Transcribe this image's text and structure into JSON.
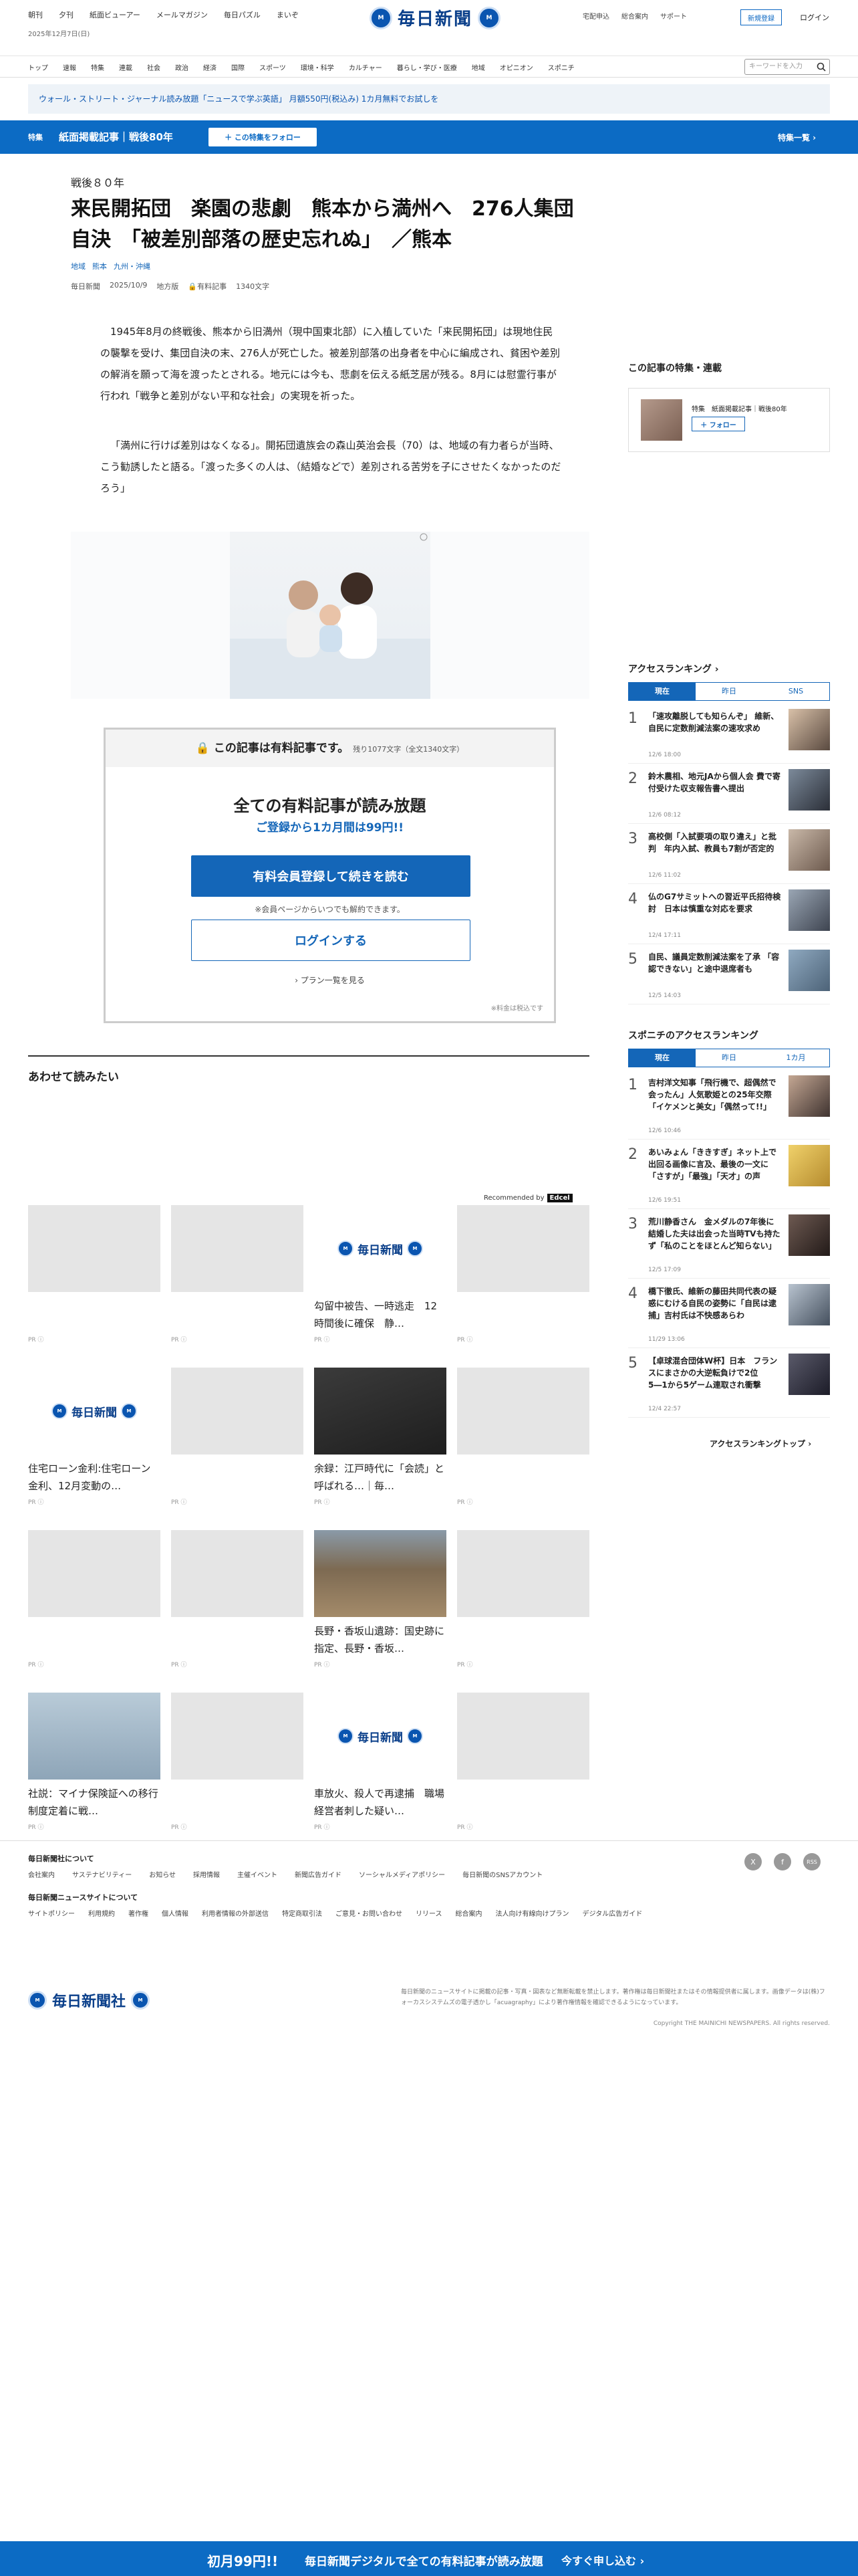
{
  "header": {
    "top_links": [
      "朝刊",
      "夕刊",
      "紙面ビューアー",
      "メールマガジン",
      "毎日パズル",
      "まいぞ"
    ],
    "date": "2025年12月7日(日)",
    "logo": "毎日新聞",
    "right_links": [
      "宅配申込",
      "総合案内",
      "サポート"
    ],
    "register": "新規登録",
    "login": "ログイン"
  },
  "nav": {
    "items": [
      "トップ",
      "速報",
      "特集",
      "連載",
      "社会",
      "政治",
      "経済",
      "国際",
      "スポーツ",
      "環境・科学",
      "カルチャー",
      "暮らし・学び・医療",
      "地域",
      "オピニオン",
      "スポニチ"
    ],
    "search_placeholder": "キーワードを入力"
  },
  "promo": "ウォール・ストリート・ジャーナル読み放題「ニュースで学ぶ英語」 月額550円(税込み) 1カ月無料でお試しを",
  "feature": {
    "tag": "特集",
    "title": "紙面掲載記事｜戦後80年",
    "follow": "＋ この特集をフォロー",
    "list": "特集一覧 ›"
  },
  "article": {
    "kicker": "戦後８０年",
    "headline": "来民開拓団　楽園の悲劇　熊本から満州へ　276人集団自決　「被差別部落の歴史忘れぬ」　／熊本",
    "tags": [
      "地域",
      "熊本",
      "九州・沖縄"
    ],
    "meta": [
      "毎日新聞",
      "2025/10/9",
      "地方版",
      "有料記事",
      "1340文字"
    ],
    "p1": "1945年8月の終戦後、熊本から旧満州（現中国東北部）に入植していた「来民開拓団」は現地住民の襲撃を受け、集団自決の末、276人が死亡した。被差別部落の出身者を中心に編成され、貧困や差別の解消を願って海を渡ったとされる。地元には今も、悲劇を伝える紙芝居が残る。8月には慰霊行事が行われ「戦争と差別がない平和な社会」の実現を祈った。",
    "p2": "「満州に行けば差別はなくなる」。開拓団遺族会の森山英治会長（70）は、地域の有力者らが当時、こう勧誘したと語る。「渡った多くの人は、（結婚などで）差別される苦労を子にさせたくなかったのだろう」"
  },
  "paywall": {
    "head": "この記事は有料記事です。",
    "remaining": "残り1077文字（全文1340文字）",
    "title": "全ての有料記事が読み放題",
    "subtitle": "ご登録から1カ月間は99円!!",
    "primary": "有料会員登録して続きを読む",
    "note": "※会員ページからいつでも解約できます。",
    "login": "ログインする",
    "plans": "› プラン一覧を見る",
    "tax": "※料金は税込です"
  },
  "related": {
    "title": "あわせて読みたい",
    "recommended": "Recommended by",
    "recommender": "Edcel",
    "pr": "PR ⓘ",
    "cards": [
      {
        "title": ""
      },
      {
        "title": ""
      },
      {
        "title": "勾留中被告、一時逃走　12時間後に確保　静…"
      },
      {
        "title": ""
      },
      {
        "title": "住宅ローン金利:住宅ローン金利、12月変動の…"
      },
      {
        "title": ""
      },
      {
        "title": "余録：江戸時代に「会読」と呼ばれる…｜毎…"
      },
      {
        "title": ""
      },
      {
        "title": ""
      },
      {
        "title": ""
      },
      {
        "title": "長野・香坂山遺跡：国史跡に指定、長野・香坂…"
      },
      {
        "title": ""
      },
      {
        "title": "社説：マイナ保険証への移行　制度定着に戦…"
      },
      {
        "title": ""
      },
      {
        "title": "車放火、殺人で再逮捕　職場経営者刺した疑い…"
      },
      {
        "title": ""
      }
    ]
  },
  "sidebar": {
    "series_title": "この記事の特集・連載",
    "series_label": "特集　紙面掲載記事｜戦後80年",
    "series_follow": "＋ フォロー",
    "ranking_title": "アクセスランキング ›",
    "ranking_tabs": [
      "現在",
      "昨日",
      "SNS"
    ],
    "ranking": [
      {
        "n": "1",
        "t": "「速攻離脱しても知らんぞ」 維新、自民に定数削減法案の速攻求め",
        "d": "12/6 18:00"
      },
      {
        "n": "2",
        "t": "鈴木農相、地元JAから個人会 費で寄付受けた収支報告書へ提出",
        "d": "12/6 08:12"
      },
      {
        "n": "3",
        "t": "高校側「入試要項の取り違え」と批判　年内入試、教員も7割が否定的",
        "d": "12/6 11:02"
      },
      {
        "n": "4",
        "t": "仏のG7サミットへの習近平氏招待検討　日本は慎重な対応を要求",
        "d": "12/4 17:11"
      },
      {
        "n": "5",
        "t": "自民、議員定数削減法案を了承 「容認できない」と途中退席者も",
        "d": "12/5 14:03"
      }
    ],
    "sponichi_title": "スポニチのアクセスランキング",
    "sponichi_tabs": [
      "現在",
      "昨日",
      "1カ月"
    ],
    "sponichi": [
      {
        "n": "1",
        "t": "吉村洋文知事「飛行機で、超偶然で会ったん」人気歌姫との25年交際「イケメンと美女」「偶然って!!」",
        "d": "12/6 10:46"
      },
      {
        "n": "2",
        "t": "あいみょん「ききすぎ」ネット上で出回る画像に言及、最後の一文に「さすが」「最強」「天才」の声",
        "d": "12/6 19:51"
      },
      {
        "n": "3",
        "t": "荒川静香さん　金メダルの7年後に結婚した夫は出会った当時TVも持たず「私のことをほとんど知らない」",
        "d": "12/5 17:09"
      },
      {
        "n": "4",
        "t": "橋下徹氏、維新の藤田共同代表の疑惑にむける自民の姿勢に「自民は逮捕」吉村氏は不快感あらわ",
        "d": "11/29 13:06"
      },
      {
        "n": "5",
        "t": "【卓球混合団体W杯】日本　フランスにまさかの大逆転負けで2位　5―1から5ゲーム連取され衝撃",
        "d": "12/4 22:57"
      }
    ],
    "ranking_top": "アクセスランキングトップ ›"
  },
  "footer": {
    "about": "毎日新聞社について",
    "links1": [
      "会社案内",
      "サステナビリティー",
      "お知らせ",
      "採用情報",
      "主催イベント",
      "新聞広告ガイド",
      "ソーシャルメディアポリシー",
      "毎日新聞のSNSアカウント"
    ],
    "site": "毎日新聞ニュースサイトについて",
    "links2": [
      "サイトポリシー",
      "利用規約",
      "著作権",
      "個人情報",
      "利用者情報の外部送信",
      "特定商取引法",
      "ご意見・お問い合わせ",
      "リリース",
      "総合案内",
      "法人向け有線向けプラン",
      "デジタル広告ガイド"
    ],
    "logo": "毎日新聞社",
    "disclaimer": "毎日新聞のニュースサイトに掲載の記事・写真・図表など無断転載を禁止します。著作権は毎日新聞社またはその情報提供者に属します。画像データは(株)フォーカスシステムズの電子透かし「acuagraphy」により著作権情報を確認できるようになっています。",
    "copyright": "Copyright THE MAINICHI NEWSPAPERS. All rights reserved.",
    "social": [
      "X",
      "f",
      "RSS"
    ]
  },
  "bottom_bar": {
    "price": "初月99円!!",
    "text": "毎日新聞デジタルで全ての有料記事が読み放題",
    "cta": "今すぐ申し込む ›"
  }
}
